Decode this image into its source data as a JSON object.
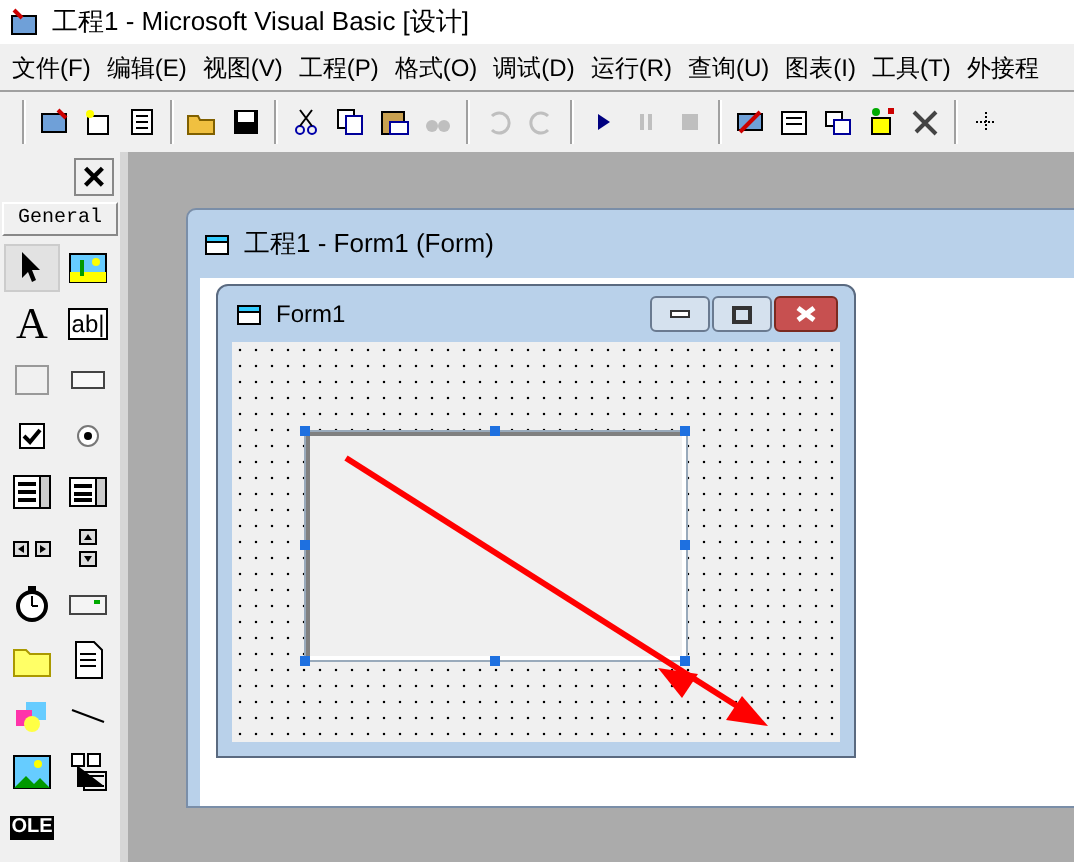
{
  "window": {
    "title": "工程1 - Microsoft Visual Basic [设计]"
  },
  "menu": [
    "文件(F)",
    "编辑(E)",
    "视图(V)",
    "工程(P)",
    "格式(O)",
    "调试(D)",
    "运行(R)",
    "查询(U)",
    "图表(I)",
    "工具(T)",
    "外接程"
  ],
  "toolbar": [
    {
      "disabled": false
    },
    {
      "disabled": false
    },
    {
      "disabled": false
    },
    {
      "disabled": false
    },
    {
      "disabled": false
    },
    {
      "disabled": false
    },
    {
      "disabled": false
    },
    {
      "disabled": false
    },
    {
      "disabled": true
    },
    {
      "disabled": true
    },
    {
      "disabled": true
    },
    {
      "disabled": false
    },
    {
      "disabled": true
    },
    {
      "disabled": true
    },
    {
      "disabled": false
    },
    {
      "disabled": false
    },
    {
      "disabled": false
    },
    {
      "disabled": false
    },
    {
      "disabled": false
    },
    {
      "disabled": false
    }
  ],
  "toolbox": {
    "close": "×",
    "tab": "General",
    "tools": [
      {
        "selected": true
      },
      {
        "selected": false
      },
      {
        "selected": false,
        "glyph": "A"
      },
      {
        "selected": false,
        "glyph": "ab|"
      },
      {
        "selected": false
      },
      {
        "selected": false
      },
      {
        "selected": false
      },
      {
        "selected": false
      },
      {
        "selected": false
      },
      {
        "selected": false
      },
      {
        "selected": false
      },
      {
        "selected": false
      },
      {
        "selected": false
      },
      {
        "selected": false
      },
      {
        "selected": false
      },
      {
        "selected": false
      },
      {
        "selected": false
      },
      {
        "selected": false
      },
      {
        "selected": false
      },
      {
        "selected": false
      },
      {
        "selected": false,
        "glyph": "OLE"
      }
    ]
  },
  "project_window": {
    "title": "工程1 - Form1 (Form)"
  },
  "form": {
    "title": "Form1",
    "frame": {
      "selected": true
    }
  }
}
